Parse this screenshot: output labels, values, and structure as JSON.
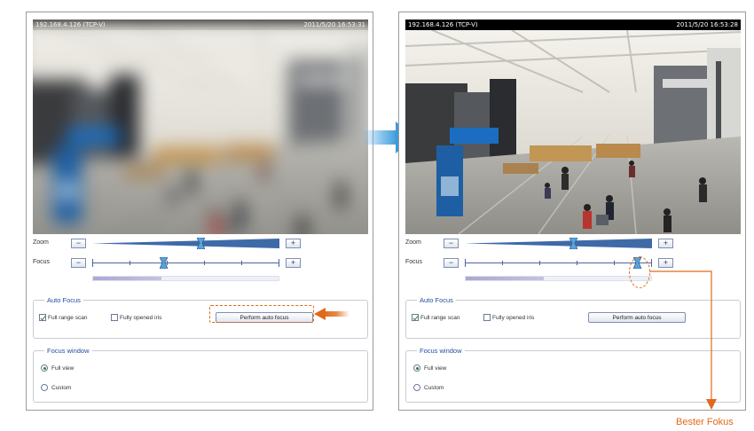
{
  "colors": {
    "accent_orange": "#e06a1a",
    "legend_blue": "#1d4f9c",
    "slider_blue": "#3f6aa8",
    "progress_fill": "#aaa8d4",
    "transition_arrow": "#5fb0e6"
  },
  "left_panel": {
    "video": {
      "ip": "192.168.4.126 (TCP-V)",
      "timestamp": "2011/5/20 16:53:31",
      "state": "blurred"
    },
    "zoom_label": "Zoom",
    "focus_label": "Focus",
    "minus_symbol": "−",
    "plus_symbol": "+",
    "zoom_level": 0.58,
    "focus_level": 0.38,
    "focus_progress": 0.37,
    "auto_focus": {
      "legend": "Auto Focus",
      "full_range_scan_label": "Full range scan",
      "full_range_scan_checked": true,
      "fully_opened_iris_label": "Fully opened iris",
      "fully_opened_iris_checked": false,
      "perform_button_label": "Perform auto focus",
      "perform_button_highlighted": true
    },
    "focus_window": {
      "legend": "Focus window",
      "full_view_label": "Full view",
      "custom_label": "Custom",
      "selected": "Full view"
    }
  },
  "right_panel": {
    "video": {
      "ip": "192.168.4.126 (TCP-V)",
      "timestamp": "2011/5/20 16:53:28",
      "state": "focused"
    },
    "zoom_label": "Zoom",
    "focus_label": "Focus",
    "minus_symbol": "−",
    "plus_symbol": "+",
    "zoom_level": 0.58,
    "focus_level": 0.92,
    "focus_progress": 0.42,
    "auto_focus": {
      "legend": "Auto Focus",
      "full_range_scan_label": "Full range scan",
      "full_range_scan_checked": true,
      "fully_opened_iris_label": "Fully opened iris",
      "fully_opened_iris_checked": false,
      "perform_button_label": "Perform auto focus"
    },
    "focus_window": {
      "legend": "Focus window",
      "full_view_label": "Full view",
      "custom_label": "Custom",
      "selected": "Full view"
    }
  },
  "annotation": {
    "best_focus_label": "Bester Fokus"
  }
}
